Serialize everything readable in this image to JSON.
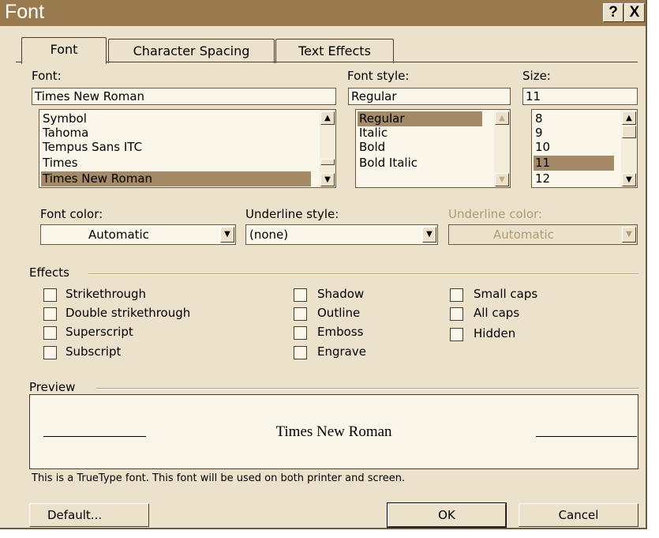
{
  "window": {
    "title": "Font",
    "help_label": "?",
    "close_label": "X"
  },
  "tabs": [
    {
      "label": "Font",
      "active": true
    },
    {
      "label": "Character Spacing",
      "active": false
    },
    {
      "label": "Text Effects",
      "active": false
    }
  ],
  "font": {
    "label": "Font:",
    "value": "Times New Roman",
    "items": [
      "Symbol",
      "Tahoma",
      "Tempus Sans ITC",
      "Times",
      "Times New Roman"
    ],
    "selected": "Times New Roman"
  },
  "font_style": {
    "label": "Font style:",
    "value": "Regular",
    "items": [
      "Regular",
      "Italic",
      "Bold",
      "Bold Italic"
    ],
    "selected": "Regular"
  },
  "size": {
    "label": "Size:",
    "value": "11",
    "items": [
      "8",
      "9",
      "10",
      "11",
      "12"
    ],
    "selected": "11"
  },
  "font_color": {
    "label": "Font color:",
    "value": "Automatic"
  },
  "underline_style": {
    "label": "Underline style:",
    "value": "(none)"
  },
  "underline_color": {
    "label": "Underline color:",
    "value": "Automatic",
    "disabled": true
  },
  "effects": {
    "label": "Effects",
    "col1": [
      "Strikethrough",
      "Double strikethrough",
      "Superscript",
      "Subscript"
    ],
    "col2": [
      "Shadow",
      "Outline",
      "Emboss",
      "Engrave"
    ],
    "col3": [
      "Small caps",
      "All caps",
      "Hidden"
    ]
  },
  "preview": {
    "label": "Preview",
    "text": "Times New Roman"
  },
  "note": "This is a TrueType font. This font will be used on both printer and screen.",
  "buttons": {
    "default": "Default...",
    "ok": "OK",
    "cancel": "Cancel"
  },
  "colors": {
    "title_bar": "#9a7b50",
    "dialog": "#ece2cc",
    "selection": "#a58a68"
  }
}
